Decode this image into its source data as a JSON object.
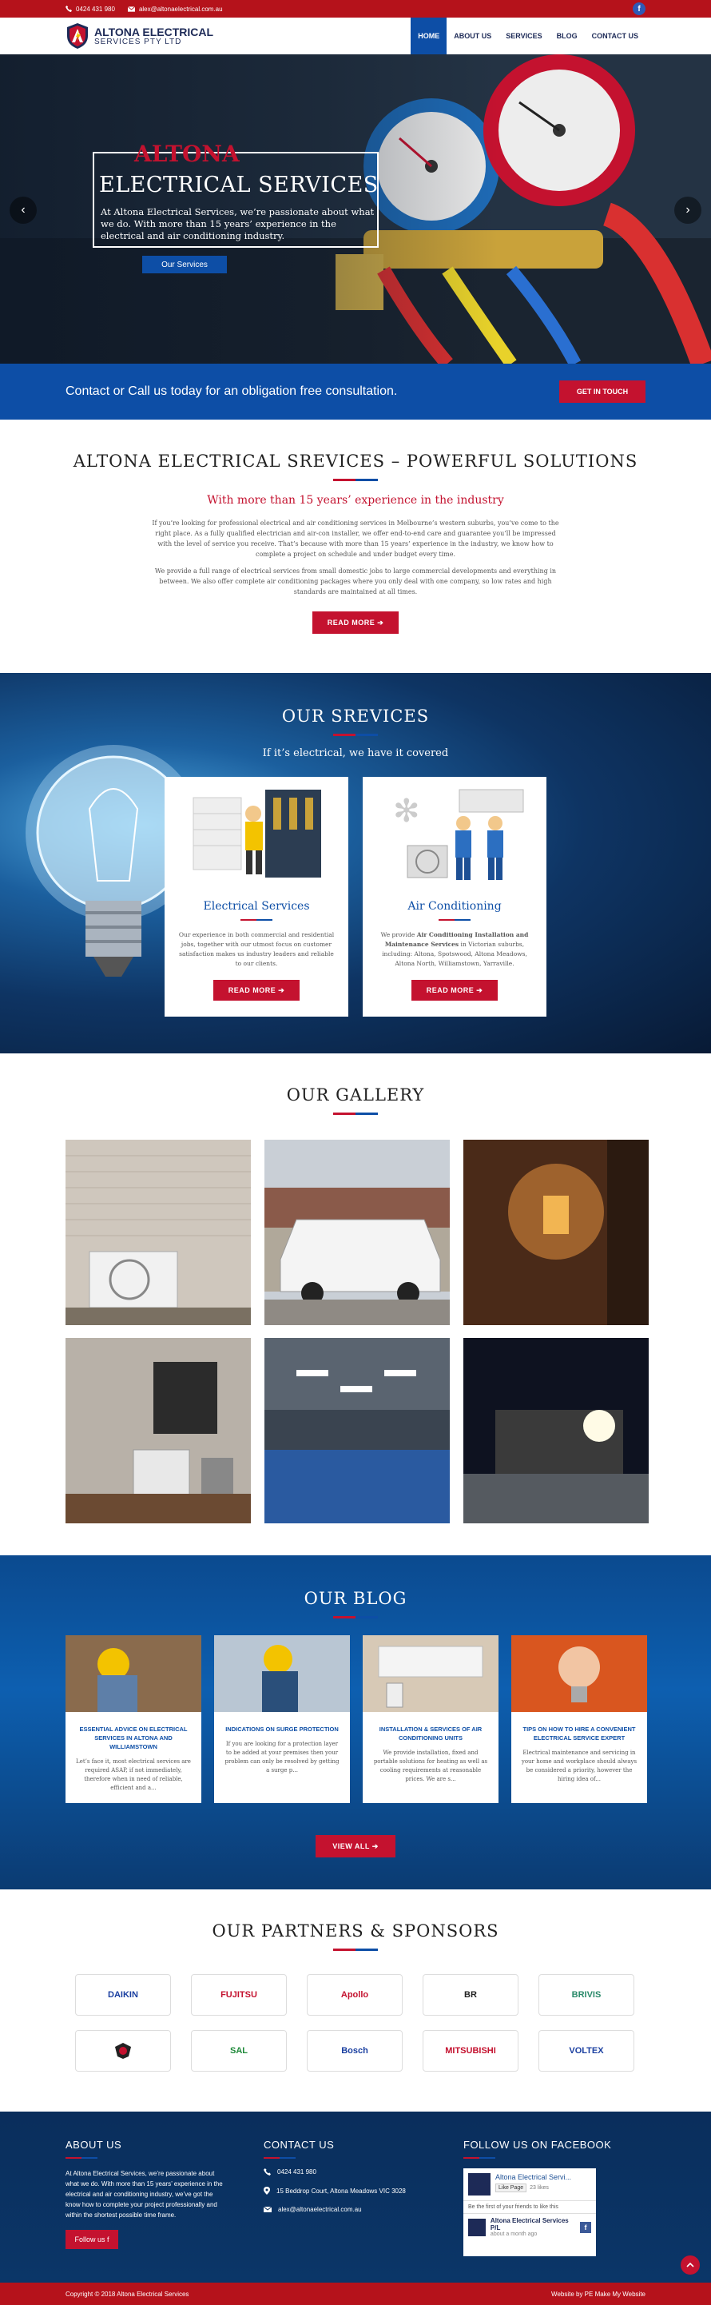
{
  "topbar": {
    "phone": "0424 431 980",
    "email": "alex@altonaelectrical.com.au",
    "facebook_label": "f"
  },
  "header": {
    "logo_line1": "ALTONA ELECTRICAL",
    "logo_line2": "SERVICES PTY LTD"
  },
  "nav": [
    {
      "label": "HOME",
      "active": true
    },
    {
      "label": "ABOUT US",
      "active": false
    },
    {
      "label": "SERVICES",
      "active": false
    },
    {
      "label": "BLOG",
      "active": false
    },
    {
      "label": "CONTACT US",
      "active": false
    }
  ],
  "hero": {
    "title1": "ALTONA",
    "title2": "ELECTRICAL SERVICES",
    "text": "At Altona Electrical Services, we’re passionate about what we do. With more than 15 years’ experience in the electrical and air conditioning industry.",
    "button": "Our Services",
    "prev": "‹",
    "next": "›"
  },
  "cta": {
    "text": "Contact or Call us today for an obligation free consultation.",
    "button": "GET IN TOUCH"
  },
  "intro": {
    "title": "ALTONA ELECTRICAL SREVICES – POWERFUL SOLUTIONS",
    "subtitle": "With more than 15 years’ experience in the industry",
    "para1": "If you’re looking for professional electrical and air conditioning services in Melbourne’s western suburbs, you’ve come to the right place. As a fully qualified electrician and air-con installer, we offer end-to-end care and guarantee you’ll be impressed with the level of service you receive. That’s because with more than 15 years’ experience in the industry, we know how to complete a project on schedule and under budget every time.",
    "para2": "We provide a full range of electrical services from small domestic jobs to large commercial developments and everything in between. We also offer complete air conditioning packages where you only deal with one company, so low rates and high standards are maintained at all times.",
    "button": "READ MORE ➔"
  },
  "services": {
    "title": "OUR SREVICES",
    "subtitle": "If it’s electrical, we have it covered",
    "cards": [
      {
        "title": "Electrical Services",
        "text": "Our experience in both commercial and residential jobs, together with our utmost focus on customer satisfaction makes us industry leaders and reliable to our clients.",
        "button": "READ MORE ➔"
      },
      {
        "title": "Air Conditioning",
        "text_bold": "Air Conditioning Installation and Maintenance Services",
        "text_pre": "We provide ",
        "text_post": " in Victorian suburbs, including: Altona, Spotswood, Altona Meadows, Altona North, Williamstown, Yarraville.",
        "button": "READ MORE ➔"
      }
    ]
  },
  "gallery": {
    "title": "OUR GALLERY"
  },
  "blog": {
    "title": "OUR BLOG",
    "posts": [
      {
        "title": "ESSENTIAL ADVICE ON ELECTRICAL SERVICES IN ALTONA AND WILLIAMSTOWN",
        "excerpt": "Let’s face it, most electrical services are required ASAP, if not immediately, therefore when in need of reliable, efficient and a..."
      },
      {
        "title": "INDICATIONS ON SURGE PROTECTION",
        "excerpt": "If you are looking for a protection layer to be added at your premises then your problem can only be resolved by getting a surge p..."
      },
      {
        "title": "INSTALLATION & SERVICES OF AIR CONDITIONING UNITS",
        "excerpt": "We provide installation, fixed and portable solutions for heating as well as cooling requirements at reasonable prices. We are s..."
      },
      {
        "title": "TIPS ON HOW TO HIRE A CONVENIENT ELECTRICAL SERVICE EXPERT",
        "excerpt": "Electrical maintenance and servicing in your home and workplace should always be considered a priority, however the hiring idea of..."
      }
    ],
    "button": "VIEW ALL ➔"
  },
  "partners": {
    "title": "OUR PARTNERS & SPONSORS",
    "logos": [
      "DAIKIN",
      "FUJITSU",
      "Apollo",
      "BR",
      "BRIVIS",
      "",
      "SAL",
      "Bosch",
      "MITSUBISHI",
      "VOLTEX"
    ],
    "colors": [
      "#1a3fa0",
      "#c4122f",
      "#c4122f",
      "#222222",
      "#2a8a6a",
      "#222222",
      "#1f8a3a",
      "#1a3fa0",
      "#c4122f",
      "#1a3fa0"
    ]
  },
  "footer": {
    "about_title": "ABOUT US",
    "about_text": "At Altona Electrical Services, we’re passionate about what we do. With more than 15 years’ experience in the electrical and air conditioning industry, we’ve got the know how to complete your project professionally and within the shortest possible time frame.",
    "follow_btn": "Follow us f",
    "contact_title": "CONTACT US",
    "phone": "0424 431 980",
    "address": "15 Beddrop Court, Altona Meadows VIC 3028",
    "email": "alex@altonaelectrical.com.au",
    "fb_title": "FOLLOW US ON FACEBOOK",
    "fb_page": "Altona Electrical Servi...",
    "fb_like": "Like Page",
    "fb_likes": "23 likes",
    "fb_first": "Be the first of your friends to like this",
    "fb_post_name": "Altona Electrical Services P/L",
    "fb_post_time": "about a month ago"
  },
  "copyright": {
    "left": "Copyright © 2018 Altona Electrical Services",
    "right": "Website by PE Make My Website"
  }
}
